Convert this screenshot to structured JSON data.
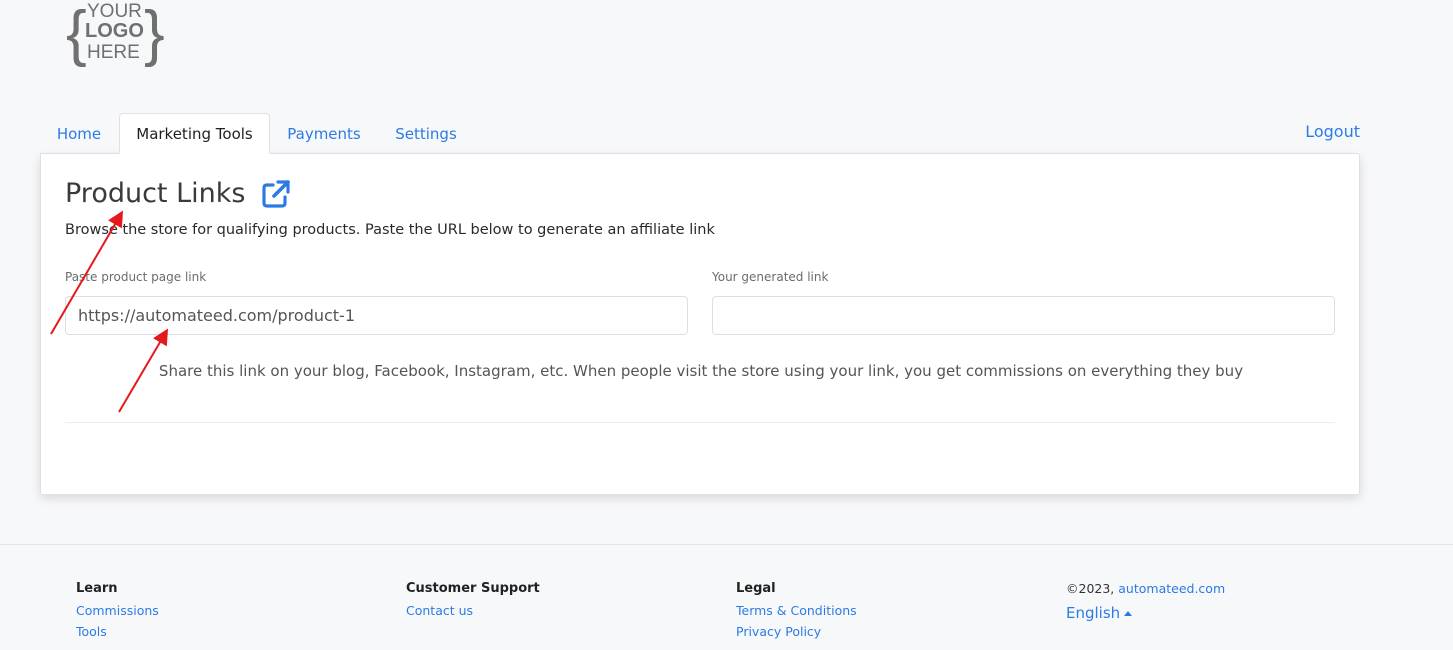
{
  "logo": {
    "line1": "YOUR",
    "line2": "LOGO",
    "line3": "HERE"
  },
  "nav": {
    "tabs": [
      {
        "label": "Home",
        "active": false
      },
      {
        "label": "Marketing Tools",
        "active": true
      },
      {
        "label": "Payments",
        "active": false
      },
      {
        "label": "Settings",
        "active": false
      }
    ],
    "logout_label": "Logout"
  },
  "main": {
    "title": "Product Links",
    "description": "Browse the store for qualifying products. Paste the URL below to generate an affiliate link",
    "product_field": {
      "label": "Paste product page link",
      "value": "https://automateed.com/product-1"
    },
    "generated_field": {
      "label": "Your generated link",
      "value": ""
    },
    "help_text": "Share this link on your blog, Facebook, Instagram, etc. When people visit the store using your link, you get commissions on everything they buy"
  },
  "footer": {
    "learn": {
      "heading": "Learn",
      "links": [
        "Commissions",
        "Tools"
      ]
    },
    "support": {
      "heading": "Customer Support",
      "links": [
        "Contact us"
      ]
    },
    "legal": {
      "heading": "Legal",
      "links": [
        "Terms & Conditions",
        "Privacy Policy"
      ]
    },
    "copyright_prefix": "©2023, ",
    "copyright_link": "automateed.com",
    "language": "English"
  },
  "colors": {
    "link": "#2c7be5",
    "annotation": "#e5191c",
    "logo_gray": "#707070"
  },
  "icons": {
    "title_icon": "external-link-icon",
    "language_caret": "caret-up-icon"
  }
}
